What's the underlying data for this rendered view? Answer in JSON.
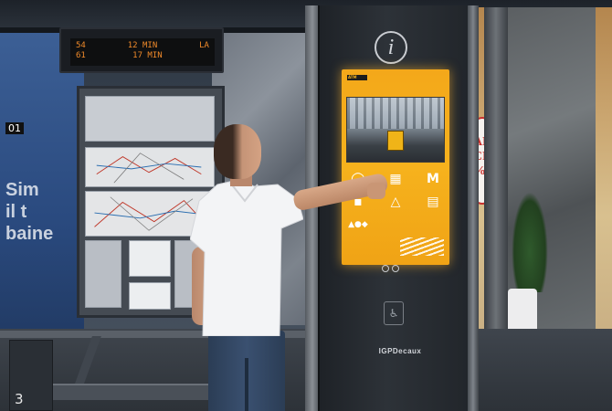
{
  "departure_board": {
    "row1_route": "54",
    "row1_time": "12 MIN",
    "row1_dest": "LA",
    "row2_route": "61",
    "row2_time": "17 MIN"
  },
  "store_left": {
    "number": "01",
    "text": "Sim\nil t\nbaine"
  },
  "kiosk": {
    "info_symbol": "i",
    "brand": "IGPDecaux",
    "screen_logo": "ATM",
    "nav_prev": "‹",
    "nav_next": "›"
  },
  "sign": {
    "text": "AL\nCE\n%"
  },
  "corner_number": "3",
  "colors": {
    "screen_yellow": "#f5ad1b",
    "departure_led": "#f08a2a",
    "jeans": "#2f4460"
  }
}
